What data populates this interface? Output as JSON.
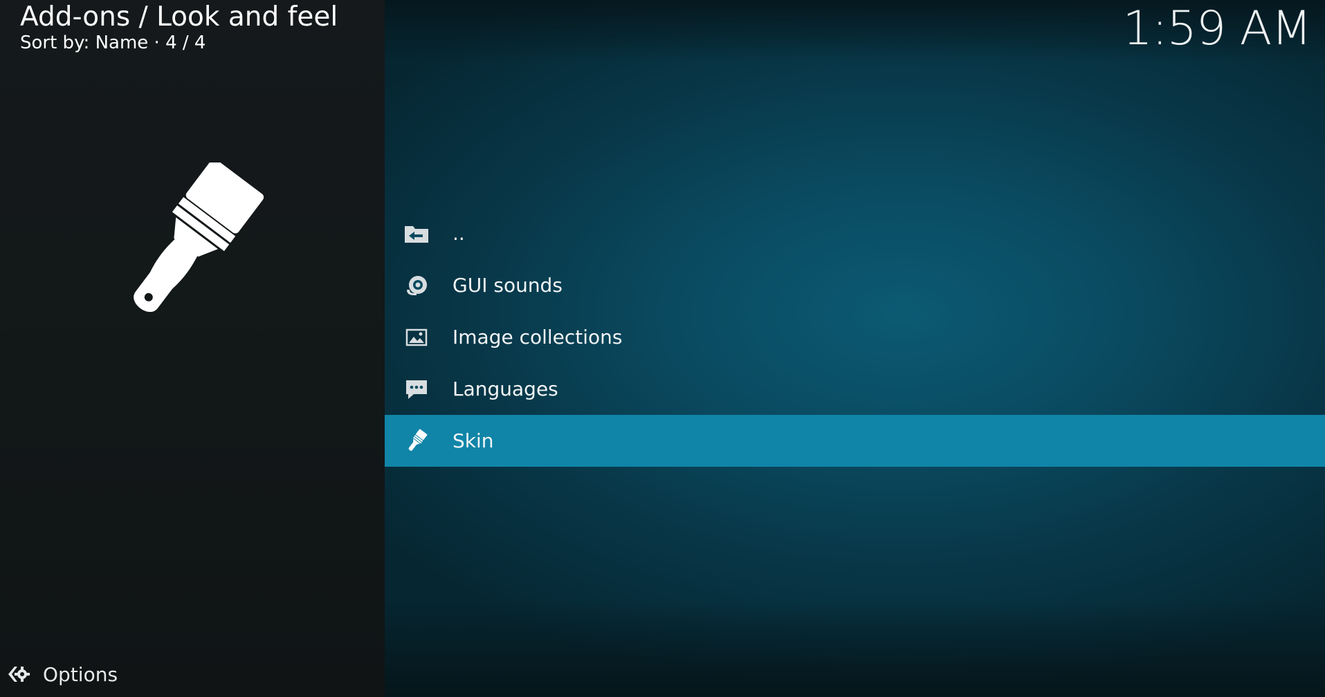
{
  "header": {
    "title": "Add-ons / Look and feel",
    "sort_line": "Sort by: Name  ·  4 / 4"
  },
  "clock": "1:59 AM",
  "preview": {
    "icon": "paintbrush-icon"
  },
  "list": {
    "items": [
      {
        "label": "..",
        "icon": "folder-back-icon",
        "selected": false
      },
      {
        "label": "GUI sounds",
        "icon": "speaker-icon",
        "selected": false
      },
      {
        "label": "Image collections",
        "icon": "image-icon",
        "selected": false
      },
      {
        "label": "Languages",
        "icon": "speech-bubble-icon",
        "selected": false
      },
      {
        "label": "Skin",
        "icon": "paintbrush-icon",
        "selected": true
      }
    ]
  },
  "footer": {
    "options_label": "Options",
    "options_icon": "options-arrow-gear-icon"
  },
  "colors": {
    "selection": "#1085a8",
    "left_panel": "#131819",
    "background": "#0a4a60"
  }
}
